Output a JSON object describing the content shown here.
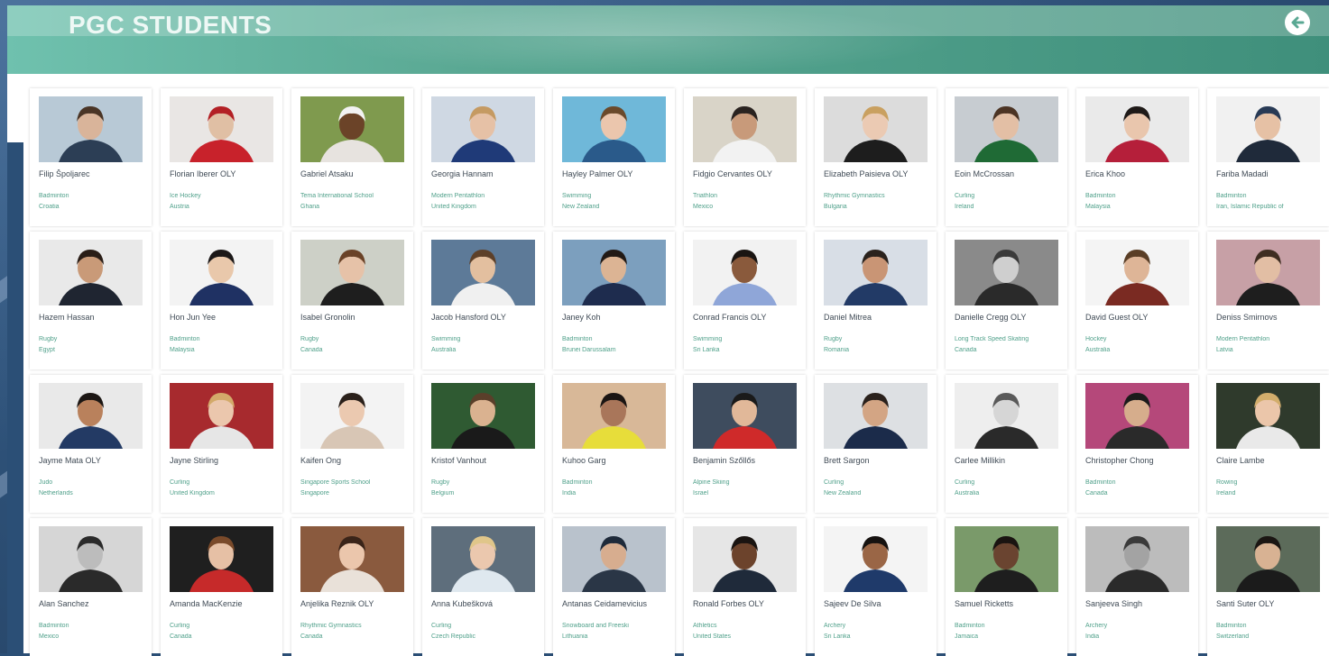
{
  "header": {
    "title": "PGC STUDENTS",
    "back_icon": "arrow-left-circle-icon"
  },
  "colors": {
    "header": "#5aa893",
    "accent_text": "#4fa08a",
    "background": "#2b4f76"
  },
  "students": [
    {
      "name": "Filip Špoljarec",
      "sport": "Badminton",
      "country": "Croatia",
      "bg": "#b8c9d6",
      "shirt": "#2c3e55",
      "skin": "#d9b49a",
      "hair": "#4a3526"
    },
    {
      "name": "Florian Iberer OLY",
      "sport": "Ice Hockey",
      "country": "Austria",
      "bg": "#e9e6e4",
      "shirt": "#c8222b",
      "skin": "#e0bfa4",
      "hair": "#b32025"
    },
    {
      "name": "Gabriel Atsaku",
      "sport": "Tema International School",
      "country": "Ghana",
      "bg": "#7f9a4e",
      "shirt": "#e7e3df",
      "skin": "#6b4328",
      "hair": "#f2f2f2"
    },
    {
      "name": "Georgia Hannam",
      "sport": "Modern Pentathlon",
      "country": "United Kingdom",
      "bg": "#cfd8e3",
      "shirt": "#1f3a78",
      "skin": "#e6c1a6",
      "hair": "#c59a62"
    },
    {
      "name": "Hayley Palmer OLY",
      "sport": "Swimming",
      "country": "New Zealand",
      "bg": "#6fb8d9",
      "shirt": "#2a5a8a",
      "skin": "#ebc6ad",
      "hair": "#6b4a2b"
    },
    {
      "name": "Fidgio Cervantes OLY",
      "sport": "Triathlon",
      "country": "Mexico",
      "bg": "#d9d4c8",
      "shirt": "#f2f2f2",
      "skin": "#c89a7a",
      "hair": "#2a2320"
    },
    {
      "name": "Elizabeth Paisieva OLY",
      "sport": "Rhythmic Gymnastics",
      "country": "Bulgaria",
      "bg": "#dcdcdc",
      "shirt": "#1d1d1d",
      "skin": "#ebcab3",
      "hair": "#c9a060"
    },
    {
      "name": "Eoin McCrossan",
      "sport": "Curling",
      "country": "Ireland",
      "bg": "#c7ccd1",
      "shirt": "#1f6a35",
      "skin": "#e3bfa5",
      "hair": "#4c3424"
    },
    {
      "name": "Erica Khoo",
      "sport": "Badminton",
      "country": "Malaysia",
      "bg": "#eaeaea",
      "shirt": "#b51f3a",
      "skin": "#e9c6ad",
      "hair": "#1f1a18"
    },
    {
      "name": "Fariba Madadi",
      "sport": "Badminton",
      "country": "Iran, Islamic Republic of",
      "bg": "#f1f1f1",
      "shirt": "#1f2a3a",
      "skin": "#e6c1a5",
      "hair": "#283a55"
    },
    {
      "name": "Hazem Hassan",
      "sport": "Rugby",
      "country": "Egypt",
      "bg": "#e9e9e9",
      "shirt": "#1f2531",
      "skin": "#c99a78",
      "hair": "#2a1e17"
    },
    {
      "name": "Hon Jun Yee",
      "sport": "Badminton",
      "country": "Malaysia",
      "bg": "#f3f3f3",
      "shirt": "#1f3163",
      "skin": "#e9c8ab",
      "hair": "#1b1818"
    },
    {
      "name": "Isabel Gronolin",
      "sport": "Rugby",
      "country": "Canada",
      "bg": "#cdd0c7",
      "shirt": "#1e1e1e",
      "skin": "#e6c2a8",
      "hair": "#6a4227"
    },
    {
      "name": "Jacob Hansford OLY",
      "sport": "Swimming",
      "country": "Australia",
      "bg": "#5d7a98",
      "shirt": "#f0f0f0",
      "skin": "#e3bf9f",
      "hair": "#5d4029"
    },
    {
      "name": "Janey Koh",
      "sport": "Badminton",
      "country": "Brunei Darussalam",
      "bg": "#7c9fbe",
      "shirt": "#1e2c4e",
      "skin": "#dcb494",
      "hair": "#221a16"
    },
    {
      "name": "Conrad Francis OLY",
      "sport": "Swimming",
      "country": "Sri Lanka",
      "bg": "#f2f2f2",
      "shirt": "#8fa6d8",
      "skin": "#8a5a3c",
      "hair": "#1a1512"
    },
    {
      "name": "Daniel Mitrea",
      "sport": "Rugby",
      "country": "Romania",
      "bg": "#d8dee6",
      "shirt": "#223a66",
      "skin": "#c99575",
      "hair": "#2a221d"
    },
    {
      "name": "Danielle Cregg OLY",
      "sport": "Long Track Speed Skating",
      "country": "Canada",
      "bg": "#8a8a8a",
      "shirt": "#2a2a2a",
      "skin": "#cfcfcf",
      "hair": "#3a3a3a"
    },
    {
      "name": "David Guest OLY",
      "sport": "Hockey",
      "country": "Australia",
      "bg": "#f4f4f4",
      "shirt": "#7a2a22",
      "skin": "#deb597",
      "hair": "#5a3e26"
    },
    {
      "name": "Deniss Smirnovs",
      "sport": "Modern Pentathlon",
      "country": "Latvia",
      "bg": "#c7a0a6",
      "shirt": "#1e1e1e",
      "skin": "#e2bea4",
      "hair": "#3f2e22"
    },
    {
      "name": "Jayme Mata OLY",
      "sport": "Judo",
      "country": "Netherlands",
      "bg": "#e9e9e9",
      "shirt": "#233a64",
      "skin": "#b9815c",
      "hair": "#1c1714"
    },
    {
      "name": "Jayne Stirling",
      "sport": "Curling",
      "country": "United Kingdom",
      "bg": "#a72a2e",
      "shirt": "#e6e6e6",
      "skin": "#ebc7ad",
      "hair": "#d3aa6a"
    },
    {
      "name": "Kaifen Ong",
      "sport": "Singapore Sports School",
      "country": "Singapore",
      "bg": "#f3f3f3",
      "shirt": "#d8c6b5",
      "skin": "#ebc9b0",
      "hair": "#2a201a"
    },
    {
      "name": "Kristof Vanhout",
      "sport": "Rugby",
      "country": "Belgium",
      "bg": "#2f5a32",
      "shirt": "#1a1a1a",
      "skin": "#dab290",
      "hair": "#5a3f2a"
    },
    {
      "name": "Kuhoo Garg",
      "sport": "Badminton",
      "country": "India",
      "bg": "#d8b898",
      "shirt": "#e7dd3a",
      "skin": "#a9765a",
      "hair": "#1b1513"
    },
    {
      "name": "Benjamin Szőllős",
      "sport": "Alpine Skiing",
      "country": "Israel",
      "bg": "#3e4c5e",
      "shirt": "#cf2a2a",
      "skin": "#e1b899",
      "hair": "#1a1a1a"
    },
    {
      "name": "Brett Sargon",
      "sport": "Curling",
      "country": "New Zealand",
      "bg": "#dde0e3",
      "shirt": "#1b2b4a",
      "skin": "#d3a584",
      "hair": "#2a211c"
    },
    {
      "name": "Carlee Millikin",
      "sport": "Curling",
      "country": "Australia",
      "bg": "#eeeeee",
      "shirt": "#2a2a2a",
      "skin": "#d6d6d6",
      "hair": "#5a5a5a"
    },
    {
      "name": "Christopher Chong",
      "sport": "Badminton",
      "country": "Canada",
      "bg": "#b5487a",
      "shirt": "#2a2a2a",
      "skin": "#d6ad8c",
      "hair": "#1b1b1b"
    },
    {
      "name": "Claire Lambe",
      "sport": "Rowing",
      "country": "Ireland",
      "bg": "#2f3a2c",
      "shirt": "#e9e9e9",
      "skin": "#ebc6aa",
      "hair": "#d2ad6c"
    },
    {
      "name": "Alan Sanchez",
      "sport": "Badminton",
      "country": "Mexico",
      "bg": "#d6d6d6",
      "shirt": "#2a2a2a",
      "skin": "#bcbcbc",
      "hair": "#2a2a2a"
    },
    {
      "name": "Amanda MacKenzie",
      "sport": "Curling",
      "country": "Canada",
      "bg": "#1f1f1f",
      "shirt": "#c62a2a",
      "skin": "#e6c0a5",
      "hair": "#7a4a2a"
    },
    {
      "name": "Anjelika Reznik OLY",
      "sport": "Rhythmic Gymnastics",
      "country": "Canada",
      "bg": "#8a5a3e",
      "shirt": "#e9e1d9",
      "skin": "#ebc6ac",
      "hair": "#3a2419"
    },
    {
      "name": "Anna Kubešková",
      "sport": "Curling",
      "country": "Czech Republic",
      "bg": "#5e6e7c",
      "shirt": "#dfe8ef",
      "skin": "#ebc8ae",
      "hair": "#e0c68a"
    },
    {
      "name": "Antanas Ceidamevicius",
      "sport": "Snowboard and Freeski",
      "country": "Lithuania",
      "bg": "#b9c2cc",
      "shirt": "#2a3646",
      "skin": "#d7ad8f",
      "hair": "#1e2a3a"
    },
    {
      "name": "Ronald Forbes OLY",
      "sport": "Athletics",
      "country": "United States",
      "bg": "#e6e6e6",
      "shirt": "#1f2a3a",
      "skin": "#6c432c",
      "hair": "#1a1411"
    },
    {
      "name": "Sajeev De Silva",
      "sport": "Archery",
      "country": "Sri Lanka",
      "bg": "#f4f4f4",
      "shirt": "#1f3a6a",
      "skin": "#9a6646",
      "hair": "#161210"
    },
    {
      "name": "Samuel Ricketts",
      "sport": "Badminton",
      "country": "Jamaica",
      "bg": "#7a9a6a",
      "shirt": "#1e1e1e",
      "skin": "#6a4430",
      "hair": "#1a1411"
    },
    {
      "name": "Sanjeeva Singh",
      "sport": "Archery",
      "country": "India",
      "bg": "#bcbcbc",
      "shirt": "#2a2a2a",
      "skin": "#a3a3a3",
      "hair": "#3a3a3a"
    },
    {
      "name": "Santi Suter OLY",
      "sport": "Badminton",
      "country": "Switzerland",
      "bg": "#5c6b5a",
      "shirt": "#1b1b1b",
      "skin": "#d8b293",
      "hair": "#1b1613"
    }
  ]
}
